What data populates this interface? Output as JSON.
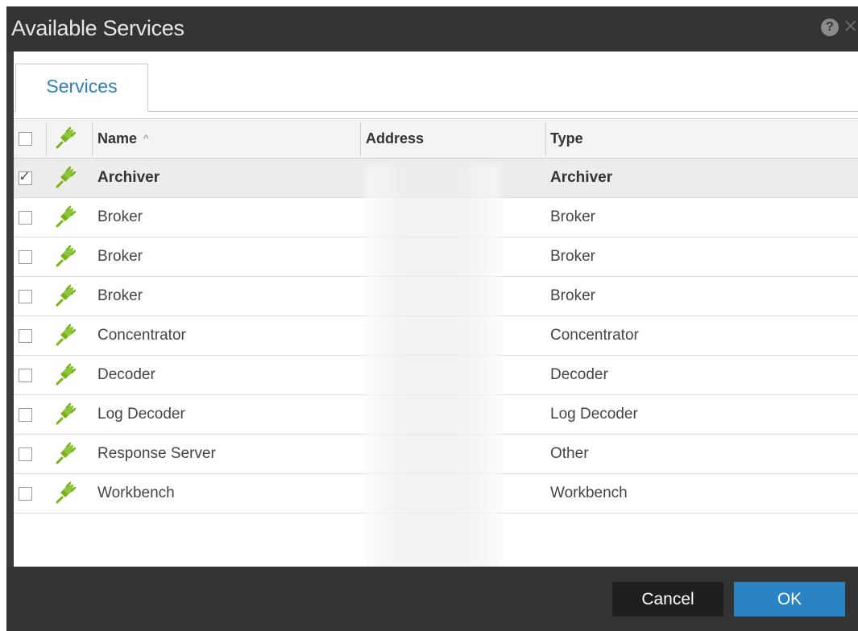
{
  "dialog": {
    "title": "Available Services",
    "help_icon": "question-circle-icon",
    "close_icon": "close-icon"
  },
  "tabs": [
    {
      "label": "Services",
      "active": true
    }
  ],
  "table": {
    "columns": {
      "select": "",
      "status_icon": "plug-icon",
      "name": "Name",
      "sort_indicator": "^",
      "address": "Address",
      "type": "Type"
    },
    "rows": [
      {
        "checked": true,
        "name": "Archiver",
        "type": "Archiver"
      },
      {
        "checked": false,
        "name": "Broker",
        "type": "Broker"
      },
      {
        "checked": false,
        "name": "Broker",
        "type": "Broker"
      },
      {
        "checked": false,
        "name": "Broker",
        "type": "Broker"
      },
      {
        "checked": false,
        "name": "Concentrator",
        "type": "Concentrator"
      },
      {
        "checked": false,
        "name": "Decoder",
        "type": "Decoder"
      },
      {
        "checked": false,
        "name": "Log Decoder",
        "type": "Log Decoder"
      },
      {
        "checked": false,
        "name": "Response Server",
        "type": "Other"
      },
      {
        "checked": false,
        "name": "Workbench",
        "type": "Workbench"
      }
    ]
  },
  "buttons": {
    "cancel": "Cancel",
    "ok": "OK"
  },
  "colors": {
    "title_bar": "#333333",
    "tab_label": "#2e7fb8",
    "ok_button": "#2a84c4",
    "cancel_button": "#1f1f1f",
    "status_icon": "#7ab317",
    "selected_row": "#ececec"
  }
}
